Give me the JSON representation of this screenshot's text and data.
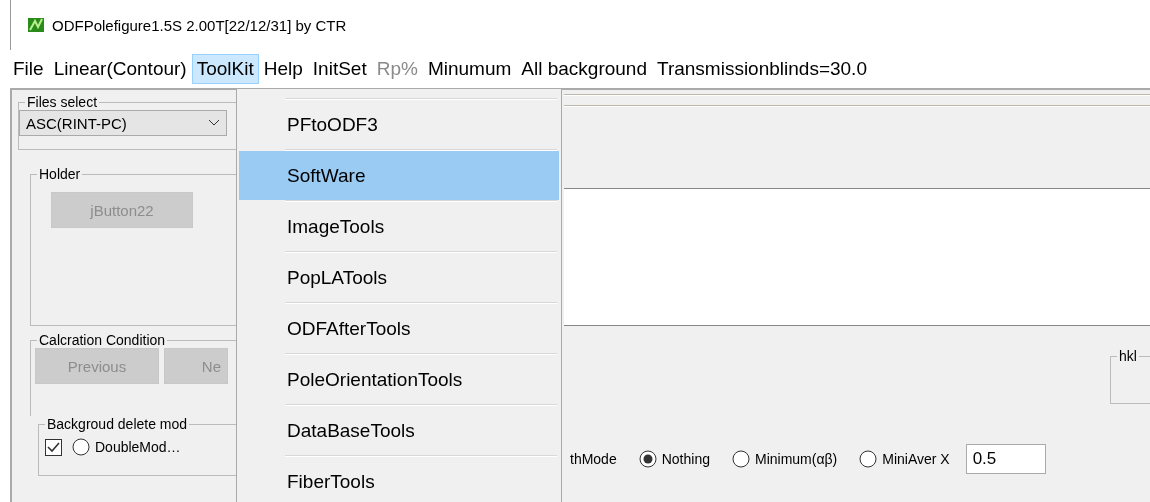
{
  "window": {
    "title": "ODFPolefigure1.5S 2.00T[22/12/31] by CTR"
  },
  "menubar": [
    {
      "label": "File",
      "selected": false,
      "disabled": false
    },
    {
      "label": "Linear(Contour)",
      "selected": false,
      "disabled": false
    },
    {
      "label": "ToolKit",
      "selected": true,
      "disabled": false
    },
    {
      "label": "Help",
      "selected": false,
      "disabled": false
    },
    {
      "label": "InitSet",
      "selected": false,
      "disabled": false
    },
    {
      "label": "Rp%",
      "selected": false,
      "disabled": true
    },
    {
      "label": "Minumum",
      "selected": false,
      "disabled": false
    },
    {
      "label": "All background",
      "selected": false,
      "disabled": false
    },
    {
      "label": "Transmissionblinds=30.0",
      "selected": false,
      "disabled": false
    }
  ],
  "toolkit_menu": [
    {
      "label": "PFtoODF3",
      "selected": false
    },
    {
      "label": "SoftWare",
      "selected": true
    },
    {
      "label": "ImageTools",
      "selected": false
    },
    {
      "label": "PopLATools",
      "selected": false
    },
    {
      "label": "ODFAfterTools",
      "selected": false
    },
    {
      "label": "PoleOrientationTools",
      "selected": false
    },
    {
      "label": "DataBaseTools",
      "selected": false
    },
    {
      "label": "FiberTools",
      "selected": false
    }
  ],
  "files_select": {
    "legend": "Files select",
    "value": "ASC(RINT-PC)"
  },
  "holder": {
    "legend": "Holder",
    "button": {
      "label": "jButton22",
      "disabled": true
    }
  },
  "calcration_condition": {
    "legend": "Calcration Condition",
    "buttons": [
      {
        "label": "Previous",
        "disabled": true
      },
      {
        "label": "Ne",
        "disabled": true
      }
    ],
    "hkl_legend": "hkl"
  },
  "background_delete": {
    "legend": "Backgroud delete mod",
    "checked": true,
    "left_options": [
      {
        "kind": "radio",
        "label": "DoubleMod…",
        "selected": false
      }
    ],
    "right_options": [
      {
        "kind": "label",
        "label": "thMode"
      },
      {
        "kind": "radio",
        "label": "Nothing",
        "selected": true
      },
      {
        "kind": "radio",
        "label": "Minimum(αβ)",
        "selected": false
      },
      {
        "kind": "radio",
        "label": "MiniAver X",
        "selected": false
      }
    ],
    "value": "0.5"
  }
}
